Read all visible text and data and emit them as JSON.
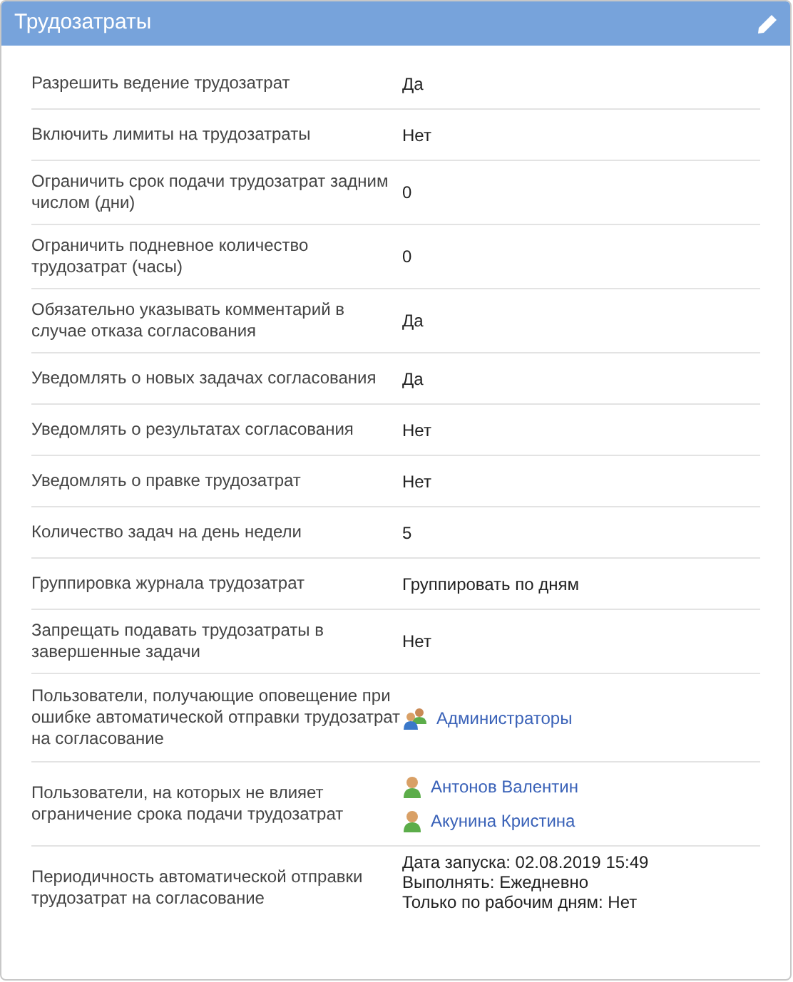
{
  "panel": {
    "title": "Трудозатраты"
  },
  "rows": [
    {
      "label": "Разрешить ведение трудозатрат",
      "kind": "text",
      "value": "Да"
    },
    {
      "label": "Включить лимиты на трудозатраты",
      "kind": "text",
      "value": "Нет"
    },
    {
      "label": "Ограничить срок подачи трудозатрат задним числом (дни)",
      "kind": "text",
      "value": "0"
    },
    {
      "label": "Ограничить подневное количество трудозатрат (часы)",
      "kind": "text",
      "value": "0"
    },
    {
      "label": "Обязательно указывать комментарий в случае отказа согласования",
      "kind": "text",
      "value": "Да"
    },
    {
      "label": "Уведомлять о новых задачах согласования",
      "kind": "text",
      "value": "Да"
    },
    {
      "label": "Уведомлять о результатах согласования",
      "kind": "text",
      "value": "Нет"
    },
    {
      "label": "Уведомлять о правке трудозатрат",
      "kind": "text",
      "value": "Нет"
    },
    {
      "label": "Количество задач на день недели",
      "kind": "text",
      "value": "5"
    },
    {
      "label": "Группировка журнала трудозатрат",
      "kind": "text",
      "value": "Группировать по дням"
    },
    {
      "label": "Запрещать подавать трудозатраты в завершенные задачи",
      "kind": "text",
      "value": "Нет"
    },
    {
      "label": "Пользователи, получающие оповещение при ошибке автоматической отправки трудозатрат на согласование",
      "kind": "users",
      "users": [
        {
          "name": "Администраторы",
          "kind": "group"
        }
      ]
    },
    {
      "label": "Пользователи, на которых не влияет ограничение срока подачи трудозатрат",
      "kind": "users",
      "users": [
        {
          "name": "Антонов Валентин",
          "kind": "person"
        },
        {
          "name": "Акунина Кристина",
          "kind": "person"
        }
      ]
    },
    {
      "label": "Периодичность автоматической отправки трудозатрат на согласование",
      "kind": "lines",
      "lines": [
        "Дата запуска: 02.08.2019 15:49",
        "Выполнять: Ежедневно",
        "Только по рабочим дням: Нет"
      ]
    }
  ]
}
